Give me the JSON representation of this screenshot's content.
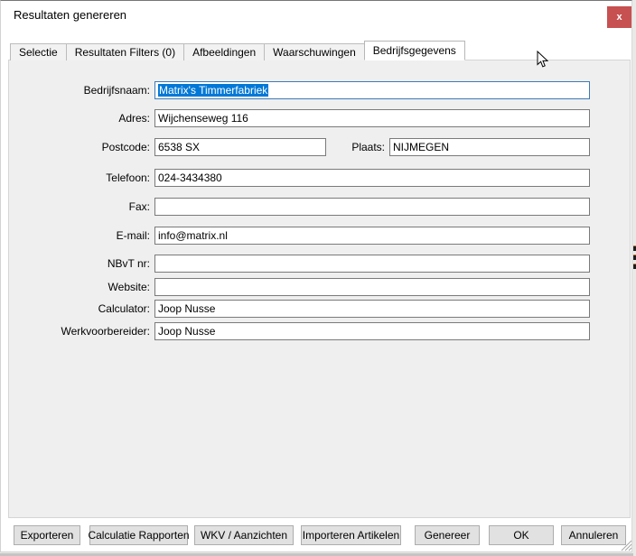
{
  "window": {
    "title": "Resultaten genereren",
    "close_label": "x"
  },
  "tabs": [
    {
      "label": "Selectie",
      "active": false
    },
    {
      "label": "Resultaten Filters (0)",
      "active": false
    },
    {
      "label": "Afbeeldingen",
      "active": false
    },
    {
      "label": "Waarschuwingen",
      "active": false
    },
    {
      "label": "Bedrijfsgegevens",
      "active": true
    }
  ],
  "form": {
    "rows": [
      {
        "label": "Bedrijfsnaam:",
        "value": "Matrix's Timmerfabriek",
        "state": "focused, text selected"
      },
      {
        "label": "Adres:",
        "value": "Wijchenseweg 116"
      },
      {
        "label": "Postcode:",
        "value": "6538 SX"
      },
      {
        "label": "Plaats:",
        "value": "NIJMEGEN"
      },
      {
        "label": "Telefoon:",
        "value": "024-3434380"
      },
      {
        "label": "Fax:",
        "value": ""
      },
      {
        "label": "E-mail:",
        "value": "info@matrix.nl"
      },
      {
        "label": "NBvT nr:",
        "value": ""
      },
      {
        "label": "Website:",
        "value": ""
      },
      {
        "label": "Calculator:",
        "value": "Joop Nusse"
      },
      {
        "label": "Werkvoorbereider:",
        "value": "Joop Nusse"
      }
    ]
  },
  "buttons": [
    "Exporteren",
    "Calculatie Rapporten",
    "WKV / Aanzichten",
    "Importeren Artikelen",
    "Genereer",
    "OK",
    "Annuleren"
  ],
  "colors": {
    "close_button": "#c75050",
    "selection_highlight": "#0078d7",
    "focused_border": "#3d7bb5",
    "tab_page_bg": "#efefef",
    "button_face": "#e1e1e1"
  }
}
